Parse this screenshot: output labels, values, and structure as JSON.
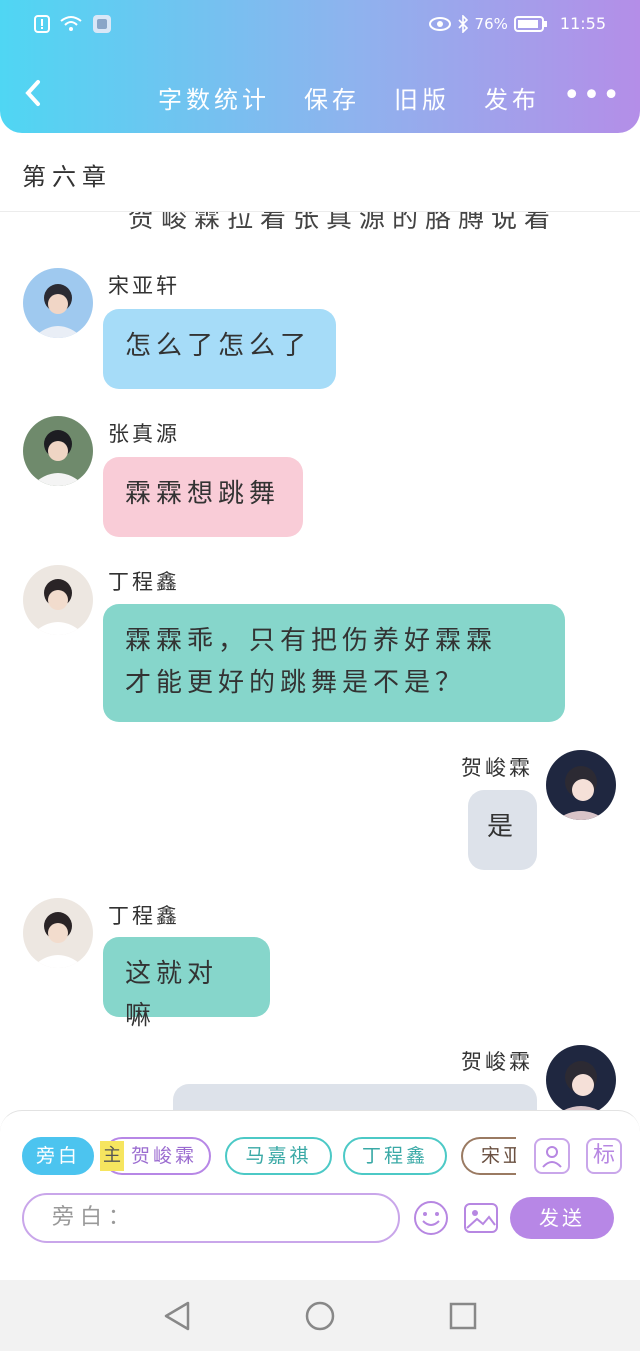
{
  "status_bar": {
    "battery": "76%",
    "time": "11:55"
  },
  "header": {
    "actions": [
      "字数统计",
      "保存",
      "旧版",
      "发布"
    ],
    "more": "•••"
  },
  "chapter_title": "第六章",
  "chat": {
    "clipped_line": "贺峻霖拉着张真源的胳膊说着",
    "messages": [
      {
        "name": "宋亚轩",
        "text": "怎么了怎么了"
      },
      {
        "name": "张真源",
        "text": "霖霖想跳舞"
      },
      {
        "name": "丁程鑫",
        "text_lines": [
          "霖霖乖，只有把伤养好霖霖",
          "才能更好的跳舞是不是？"
        ]
      },
      {
        "name": "贺峻霖",
        "text": "是"
      },
      {
        "name": "丁程鑫",
        "text": "这就对嘛"
      },
      {
        "name": "贺峻霖"
      }
    ]
  },
  "composer": {
    "chips": [
      "旁白",
      "贺峻霖",
      "马嘉祺",
      "丁程鑫",
      "宋亚"
    ],
    "main_badge": "主",
    "tag_button": "标",
    "input_placeholder": "旁白：",
    "send_label": "发送"
  },
  "colors": {
    "accent": "#b787e6",
    "teal": "#4cc9c6",
    "header_start": "#4fd6f3",
    "header_end": "#b48ee8"
  }
}
